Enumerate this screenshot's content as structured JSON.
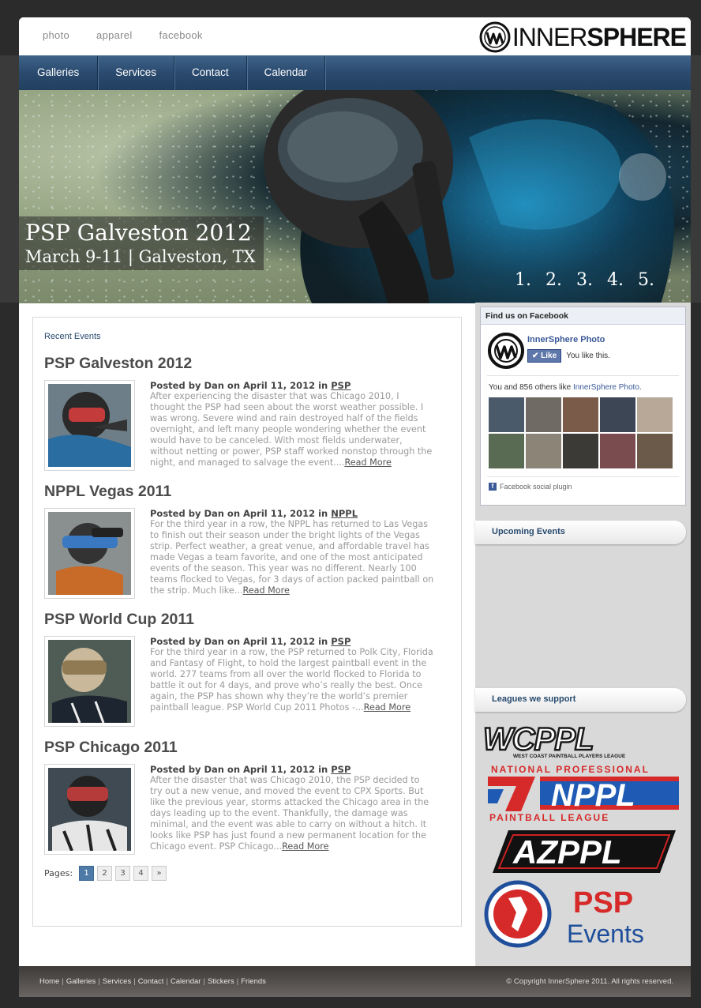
{
  "top_links": [
    "photo",
    "apparel",
    "facebook"
  ],
  "logo": {
    "text_light": "INNER",
    "text_bold": "SPHERE"
  },
  "nav": [
    "Galleries",
    "Services",
    "Contact",
    "Calendar"
  ],
  "hero": {
    "title": "PSP Galveston 2012",
    "subtitle": "March 9-11 | Galveston, TX",
    "pager": [
      "1.",
      "2.",
      "3.",
      "4.",
      "5."
    ]
  },
  "recent": {
    "section_title": "Recent Events",
    "posts": [
      {
        "title": "PSP Galveston 2012",
        "meta_prefix": "Posted by Dan on April 11, 2012 in",
        "category": "PSP",
        "excerpt": "After experiencing the disaster that was Chicago 2010, I thought the PSP had seen about the worst weather possible. I was wrong. Severe wind and rain destroyed half of the fields overnight, and left many people wondering whether the event would have to be canceled. With most fields underwater, without netting or power, PSP staff worked nonstop through the night, and managed to salvage the event....",
        "read_more": "Read More"
      },
      {
        "title": "NPPL Vegas 2011",
        "meta_prefix": "Posted by Dan on April 11, 2012 in",
        "category": "NPPL",
        "excerpt": "For the third year in a row, the NPPL has returned to Las Vegas to finish out their season under the bright lights of the Vegas strip. Perfect weather, a great venue, and affordable travel has made Vegas a team favorite, and one of the most anticipated events of the season. This year was no different. Nearly 100 teams flocked to Vegas, for 3 days of action packed paintball on the strip. Much like...",
        "read_more": "Read More"
      },
      {
        "title": "PSP World Cup 2011",
        "meta_prefix": "Posted by Dan on April 11, 2012 in",
        "category": "PSP",
        "excerpt": "For the third year in a row, the PSP returned to Polk City, Florida and Fantasy of Flight, to hold the largest paintball event in the world. 277 teams from all over the world flocked to Florida to battle it out for 4 days, and prove who’s really the best. Once again, the PSP has shown why they’re the world’s premier paintball league. PSP World Cup 2011 Photos -...",
        "read_more": "Read More"
      },
      {
        "title": "PSP Chicago 2011",
        "meta_prefix": "Posted by Dan on April 11, 2012 in",
        "category": "PSP",
        "excerpt": "After the disaster that was Chicago 2010, the PSP decided to try out a new venue, and moved the event to CPX Sports. But like the previous year, storms attacked the Chicago area in the days leading up to the event. Thankfully, the damage was minimal, and the event was able to carry on without a hitch. It looks like PSP has just found a new permanent location for the Chicago event. PSP Chicago...",
        "read_more": "Read More"
      }
    ],
    "pages_label": "Pages:",
    "pages": [
      "1",
      "2",
      "3",
      "4",
      "»"
    ]
  },
  "facebook": {
    "header": "Find us on Facebook",
    "page_name": "InnerSphere Photo",
    "like_button": "Like",
    "you_like": "You like this.",
    "count_prefix": "You and 856 others like",
    "count_link": "InnerSphere Photo",
    "count_suffix": ".",
    "plugin_label": "Facebook social plugin",
    "fan_colors": [
      "#4a5a6a",
      "#6f6a64",
      "#7a5a48",
      "#3d4655",
      "#b8a898",
      "#596b53",
      "#8d8478",
      "#3c3a36",
      "#7a4c50",
      "#6b5a4a"
    ]
  },
  "sidebar": {
    "upcoming_title": "Upcoming Events",
    "leagues_title": "Leagues we support",
    "leagues": [
      {
        "name": "WCPPL",
        "tagline": "WEST COAST PAINTBALL PLAYERS LEAGUE"
      },
      {
        "name": "NPPL",
        "top": "NATIONAL PROFESSIONAL",
        "bottom": "PAINTBALL LEAGUE"
      },
      {
        "name": "AZPPL"
      },
      {
        "name": "PSP",
        "sub": "Events"
      }
    ]
  },
  "footer": {
    "links": [
      "Home",
      "Galleries",
      "Services",
      "Contact",
      "Calendar",
      "Stickers",
      "Friends"
    ],
    "copyright": "© Copyright InnerSphere 2011. All rights reserved."
  }
}
